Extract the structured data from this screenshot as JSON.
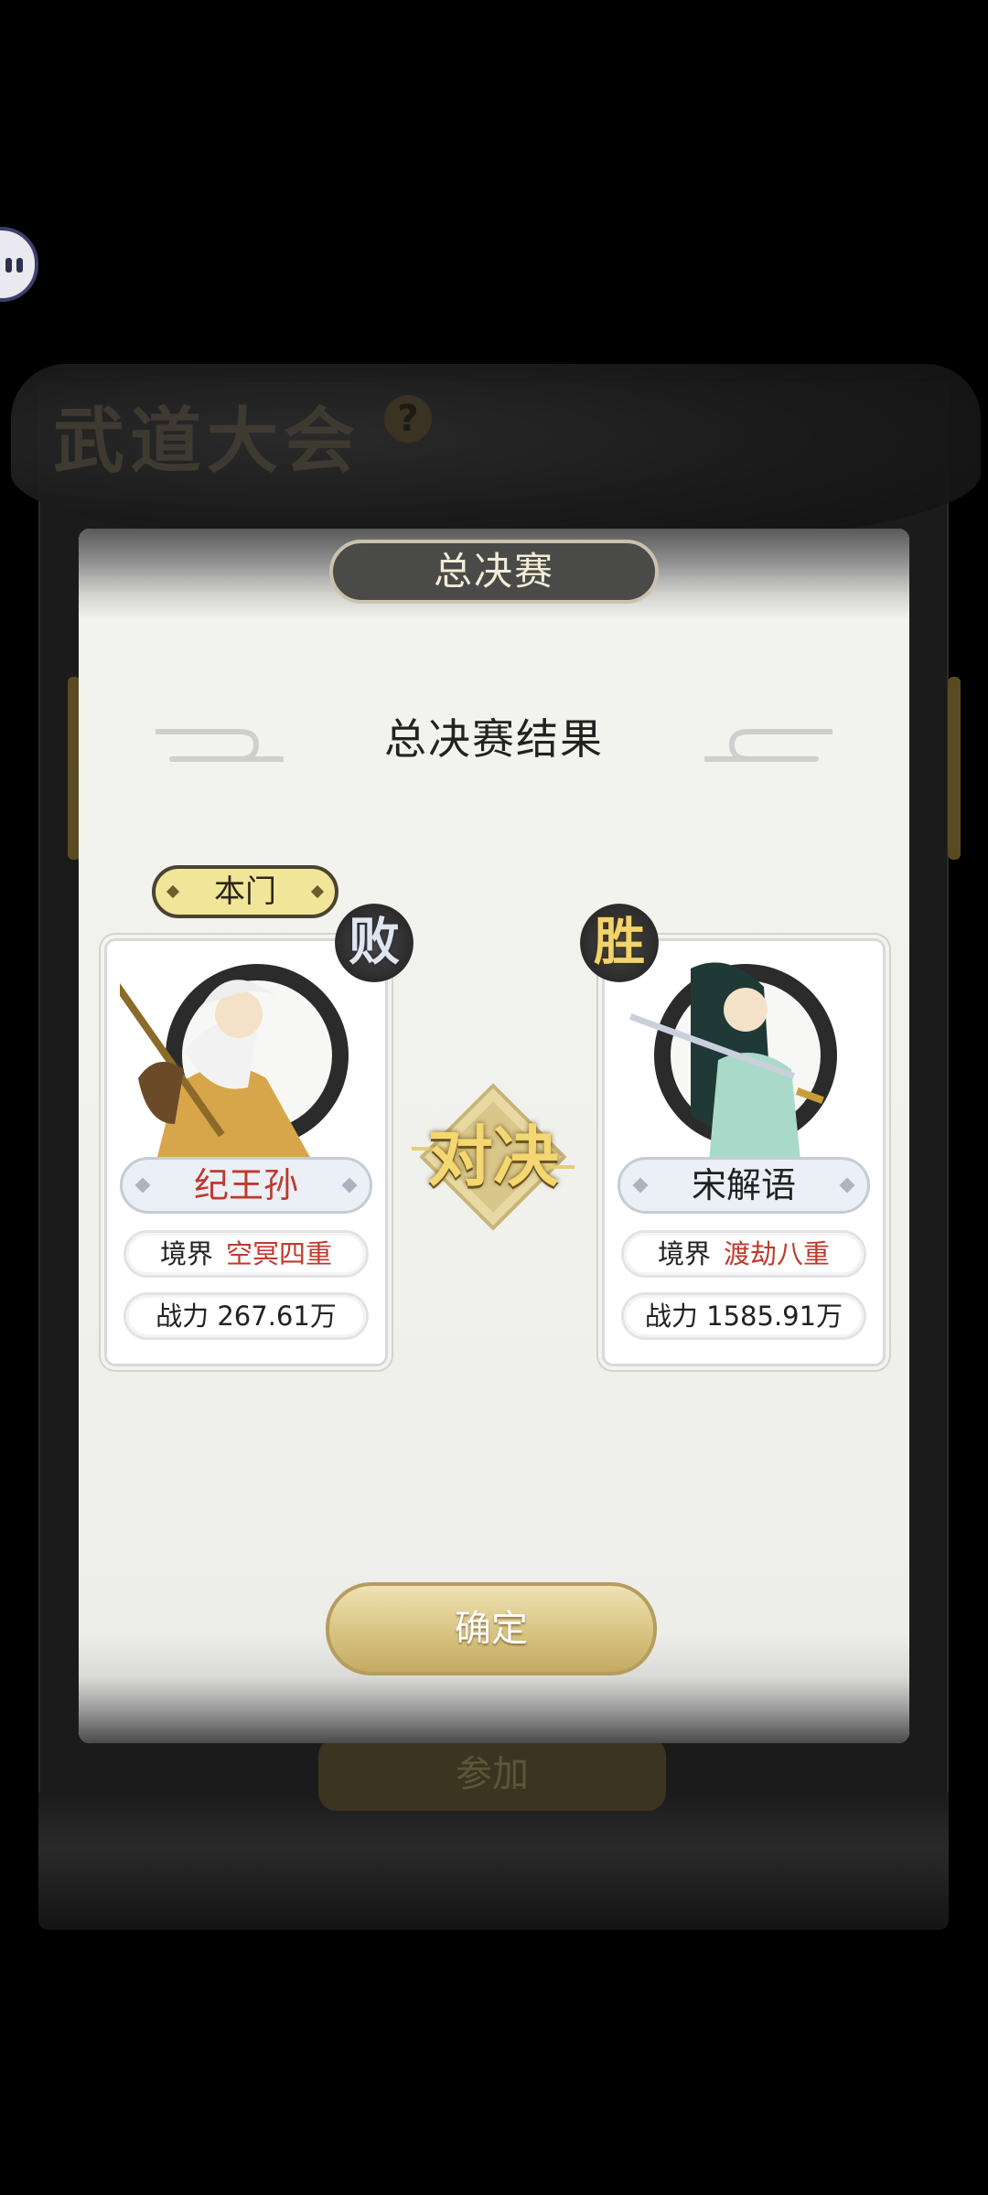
{
  "background": {
    "title": "武道大会",
    "help_icon": "?",
    "join_button": "参加"
  },
  "modal": {
    "header": "总决赛",
    "result_title": "总决赛结果",
    "vs_label": "对决",
    "confirm_button": "确定"
  },
  "left_player": {
    "tag": "本门",
    "result": "败",
    "name": "纪王孙",
    "realm_label": "境界",
    "realm_value": "空冥四重",
    "power_text": "战力 267.61万"
  },
  "right_player": {
    "result": "胜",
    "name": "宋解语",
    "realm_label": "境界",
    "realm_value": "渡劫八重",
    "power_text": "战力 1585.91万"
  },
  "colors": {
    "accent_red": "#c0392b",
    "gold": "#f4d770",
    "modal_bg": "#f3f3f0"
  }
}
